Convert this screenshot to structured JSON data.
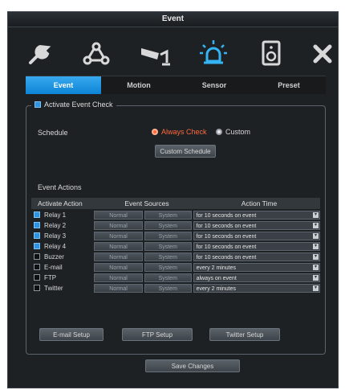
{
  "window": {
    "title": "Event"
  },
  "toolbar": {
    "icons": [
      "wrench-icon",
      "network-icon",
      "camera-icon",
      "alarm-light-icon",
      "speaker-icon",
      "close-icon"
    ]
  },
  "tabs": [
    {
      "label": "Event",
      "active": true
    },
    {
      "label": "Motion",
      "active": false
    },
    {
      "label": "Sensor",
      "active": false
    },
    {
      "label": "Preset",
      "active": false
    }
  ],
  "activate": {
    "label": "Activate Event Check",
    "checked": true
  },
  "schedule": {
    "label": "Schedule",
    "options": [
      {
        "label": "Always Check",
        "selected": true
      },
      {
        "label": "Custom",
        "selected": false
      }
    ],
    "custom_button": "Custom Schedule"
  },
  "event_actions": {
    "title": "Event Actions",
    "headers": [
      "Activate Action",
      "Event Sources",
      "Action Time"
    ],
    "rows": [
      {
        "name": "Relay 1",
        "checked": true,
        "src1": "Normal",
        "src2": "System",
        "time": "for 10 seconds on event"
      },
      {
        "name": "Relay 2",
        "checked": true,
        "src1": "Normal",
        "src2": "System",
        "time": "for 10 seconds on event"
      },
      {
        "name": "Relay 3",
        "checked": true,
        "src1": "Normal",
        "src2": "System",
        "time": "for 10 seconds on event"
      },
      {
        "name": "Relay 4",
        "checked": true,
        "src1": "Normal",
        "src2": "System",
        "time": "for 10 seconds on event"
      },
      {
        "name": "Buzzer",
        "checked": false,
        "src1": "Normal",
        "src2": "System",
        "time": "for 10 seconds on event"
      },
      {
        "name": "E-mail",
        "checked": false,
        "src1": "Normal",
        "src2": "System",
        "time": "every 2 minutes"
      },
      {
        "name": "FTP",
        "checked": false,
        "src1": "Normal",
        "src2": "System",
        "time": "always on event"
      },
      {
        "name": "Twitter",
        "checked": false,
        "src1": "Normal",
        "src2": "System",
        "time": "every 2 minutes"
      }
    ]
  },
  "setup_buttons": [
    "E-mail Setup",
    "FTP Setup",
    "Twitter Setup"
  ],
  "save_button": "Save Changes",
  "colors": {
    "accent": "#1a95e6",
    "radio_on": "#ff6a3c",
    "background": "#1e2124"
  }
}
